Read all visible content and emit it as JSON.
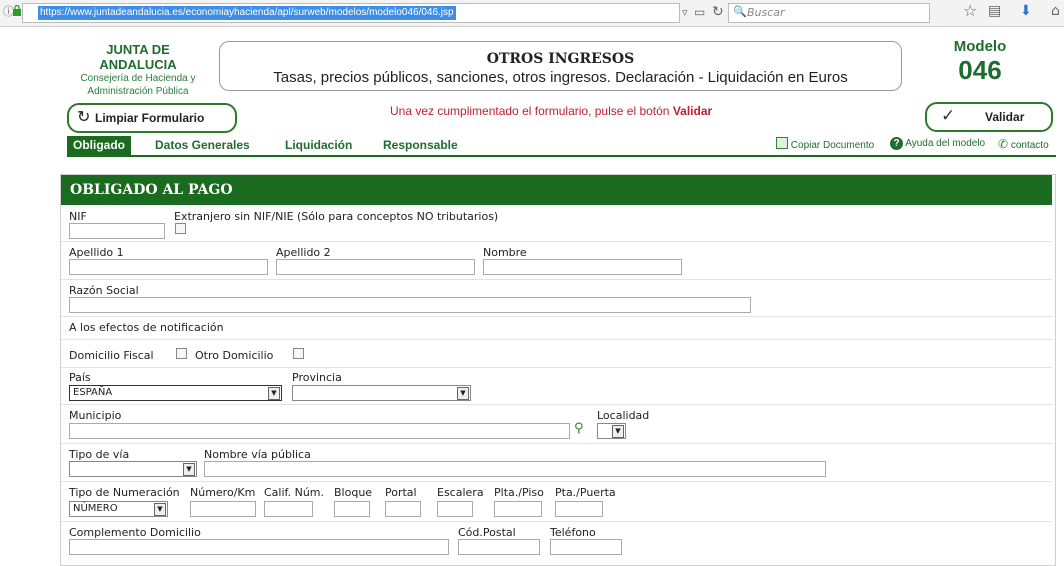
{
  "browser": {
    "url": "https://www.juntadeandalucia.es/economiayhacienda/apl/surweb/modelos/modelo046/046.jsp",
    "search_placeholder": "Buscar"
  },
  "header": {
    "org_name": "JUNTA DE ANDALUCIA",
    "org_dept_line1": "Consejería de Hacienda y",
    "org_dept_line2": "Administración Pública",
    "title": "OTROS INGRESOS",
    "subtitle": "Tasas, precios públicos, sanciones, otros ingresos. Declaración - Liquidación en Euros",
    "modelo_label": "Modelo",
    "modelo_number": "046"
  },
  "actions": {
    "clear_label": "Limpiar Formulario",
    "notice_text": "Una vez cumplimentado el formulario, pulse el botón",
    "notice_bold": "Validar",
    "validate_label": "Validar"
  },
  "tabs": [
    "Obligado",
    "Datos Generales",
    "Liquidación",
    "Responsable"
  ],
  "toolbar_links": {
    "copy": "Copiar Documento",
    "help": "Ayuda del modelo",
    "contact": "contacto"
  },
  "section": {
    "title": "OBLIGADO AL PAGO",
    "nif": "NIF",
    "extranjero": "Extranjero sin NIF/NIE (Sólo para conceptos NO tributarios)",
    "apellido1": "Apellido 1",
    "apellido2": "Apellido 2",
    "nombre": "Nombre",
    "razon_social": "Razón Social",
    "notif_note": "A los efectos de notificación",
    "domicilio_fiscal": "Domicilio Fiscal",
    "otro_domicilio": "Otro Domicilio",
    "pais": "País",
    "pais_value": "ESPAÑA",
    "provincia": "Provincia",
    "municipio": "Municipio",
    "localidad": "Localidad",
    "tipo_via": "Tipo de vía",
    "nombre_via": "Nombre vía pública",
    "tipo_numeracion": "Tipo de Numeración",
    "tipo_numeracion_value": "NÚMERO",
    "numero_km": "Número/Km",
    "calif_num": "Calif. Núm.",
    "bloque": "Bloque",
    "portal": "Portal",
    "escalera": "Escalera",
    "plta_piso": "Plta./Piso",
    "pta_puerta": "Pta./Puerta",
    "complemento": "Complemento Domicilio",
    "cod_postal": "Cód.Postal",
    "telefono": "Teléfono"
  }
}
